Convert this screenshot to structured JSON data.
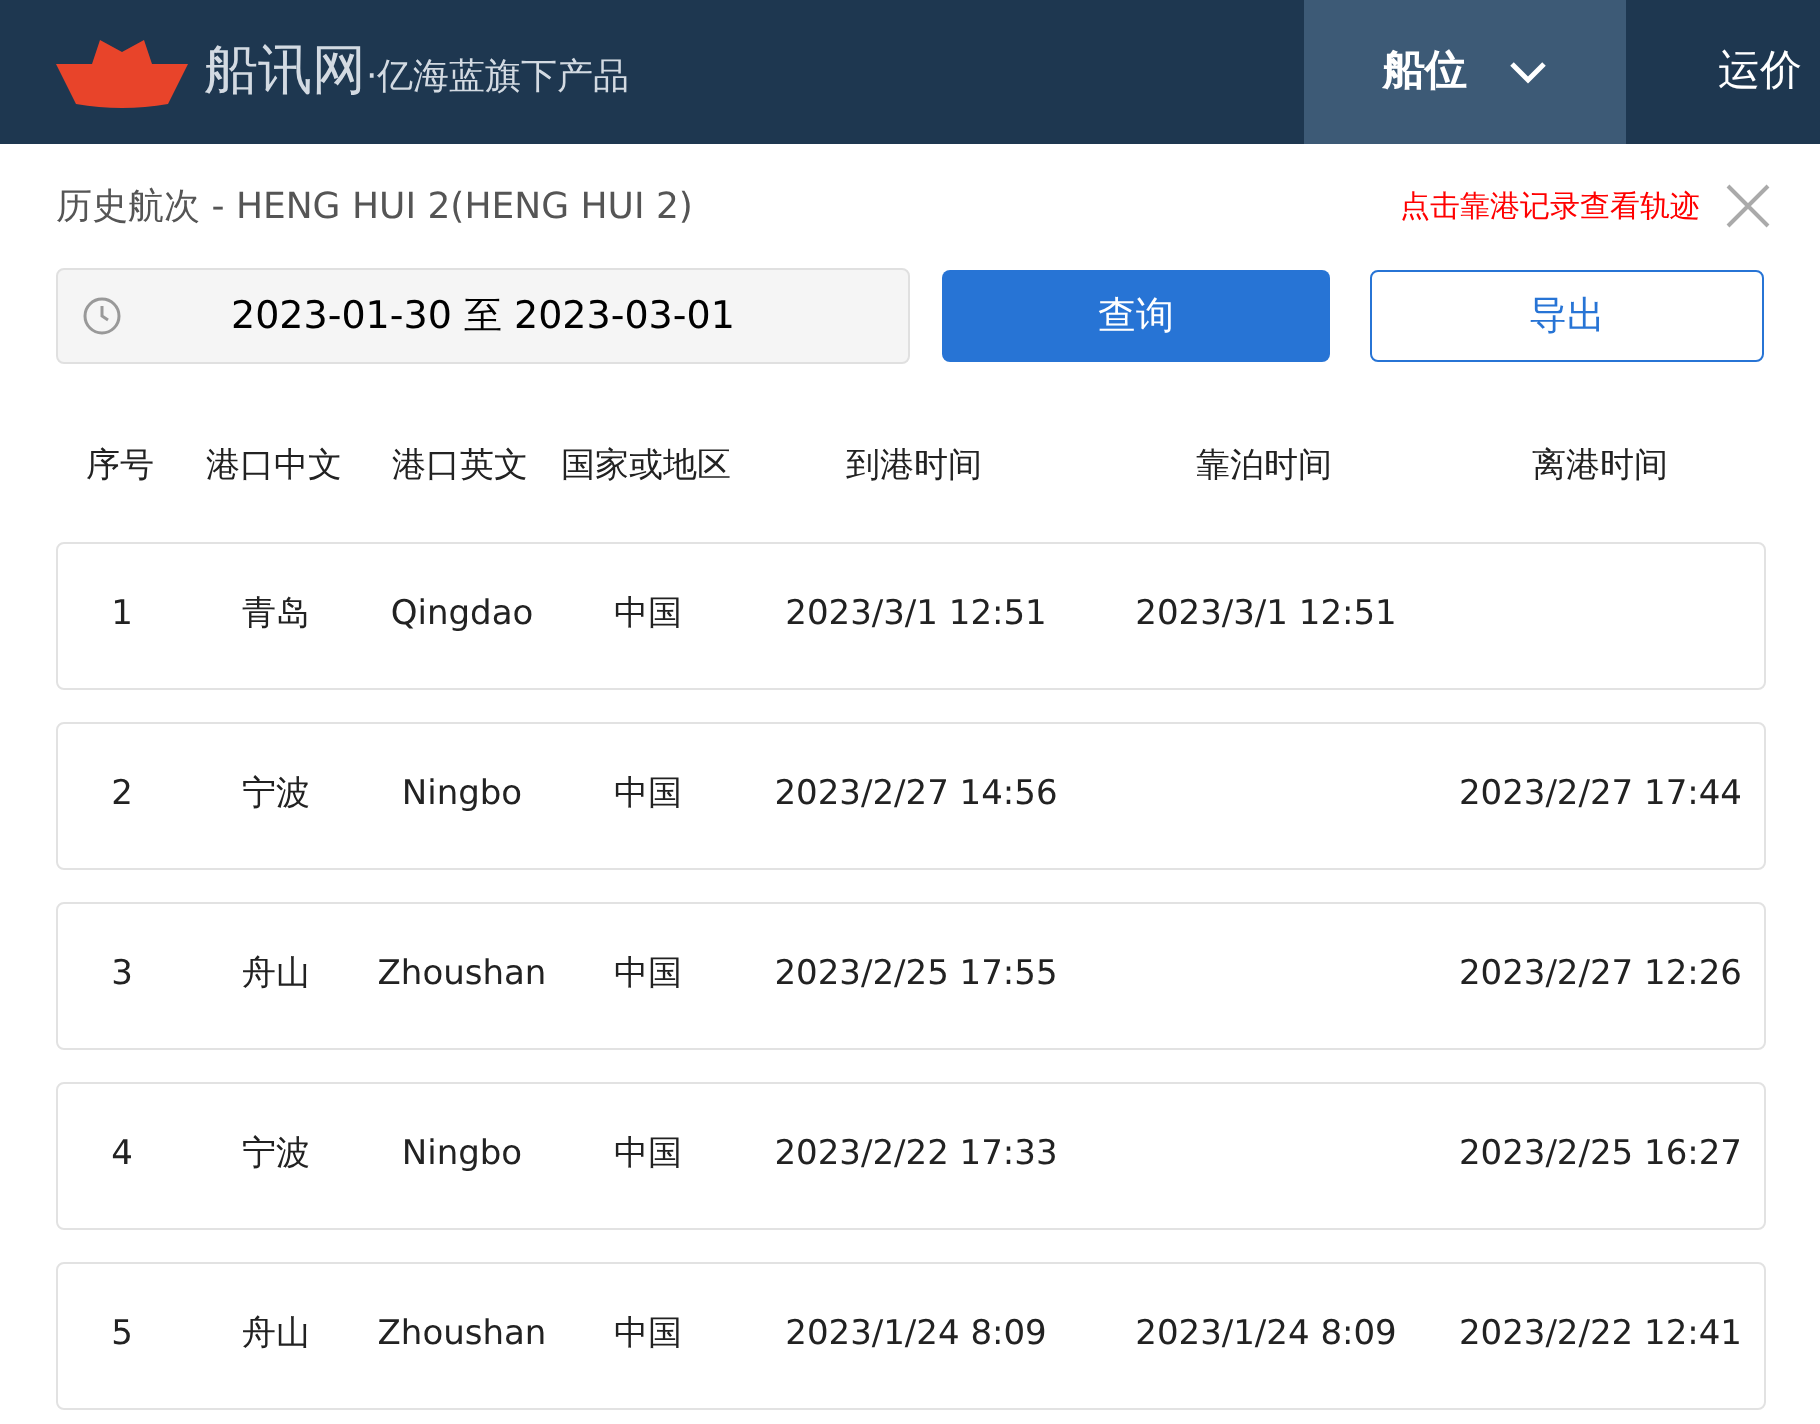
{
  "header": {
    "brand": "船讯网",
    "tagline": "·亿海蓝旗下产品",
    "nav": [
      {
        "label": "船位",
        "selected": true,
        "dropdown": true
      },
      {
        "label": "运价",
        "selected": false,
        "dropdown": false
      }
    ]
  },
  "panel": {
    "title": "历史航次 - HENG HUI 2(HENG HUI 2)",
    "hint": "点击靠港记录查看轨迹",
    "date_range": "2023-01-30 至 2023-03-01",
    "query_button": "查询",
    "export_button": "导出"
  },
  "table": {
    "columns": [
      "序号",
      "港口中文",
      "港口英文",
      "国家或地区",
      "到港时间",
      "靠泊时间",
      "离港时间"
    ],
    "rows": [
      {
        "cells": [
          "1",
          "青岛",
          "Qingdao",
          "中国",
          "2023/3/1 12:51",
          "2023/3/1 12:51",
          null
        ]
      },
      {
        "cells": [
          "2",
          "宁波",
          "Ningbo",
          "中国",
          "2023/2/27 14:56",
          null,
          "2023/2/27 17:44"
        ]
      },
      {
        "cells": [
          "3",
          "舟山",
          "Zhoushan",
          "中国",
          "2023/2/25 17:55",
          null,
          "2023/2/27 12:26"
        ]
      },
      {
        "cells": [
          "4",
          "宁波",
          "Ningbo",
          "中国",
          "2023/2/22 17:33",
          null,
          "2023/2/25 16:27"
        ]
      },
      {
        "cells": [
          "5",
          "舟山",
          "Zhoushan",
          "中国",
          "2023/1/24 8:09",
          "2023/1/24 8:09",
          "2023/2/22 12:41"
        ]
      }
    ]
  }
}
